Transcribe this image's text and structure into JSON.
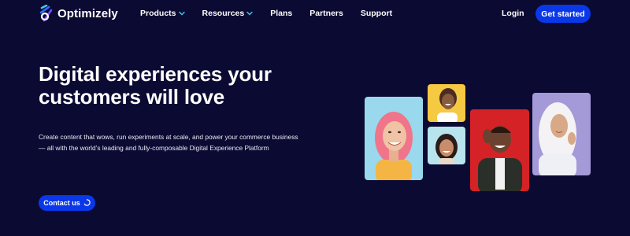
{
  "nav": {
    "brand": "Optimizely",
    "items": [
      {
        "label": "Products",
        "has_dropdown": true
      },
      {
        "label": "Resources",
        "has_dropdown": true
      },
      {
        "label": "Plans",
        "has_dropdown": false
      },
      {
        "label": "Partners",
        "has_dropdown": false
      },
      {
        "label": "Support",
        "has_dropdown": false
      }
    ],
    "login": "Login",
    "cta": "Get started"
  },
  "hero": {
    "headline_line1": "Digital experiences your",
    "headline_line2": "customers will love",
    "subtext_line1": "Create content that wows, run experiments at scale, and power your commerce business",
    "subtext_line2": "— all with the world’s leading and fully-composable Digital Experience Platform",
    "contact_button": "Contact us"
  },
  "colors": {
    "background": "#0b0a33",
    "primary_button": "#0a37e8",
    "chevron": "#3fc8f2",
    "photo_backgrounds": [
      "#9ad8ee",
      "#f5c942",
      "#b8e4ee",
      "#d42227",
      "#a49ad8"
    ]
  },
  "icons": {
    "logo": "optimizely-logo-icon",
    "chevron": "chevron-down-icon",
    "loading": "spinner-ring-icon"
  }
}
